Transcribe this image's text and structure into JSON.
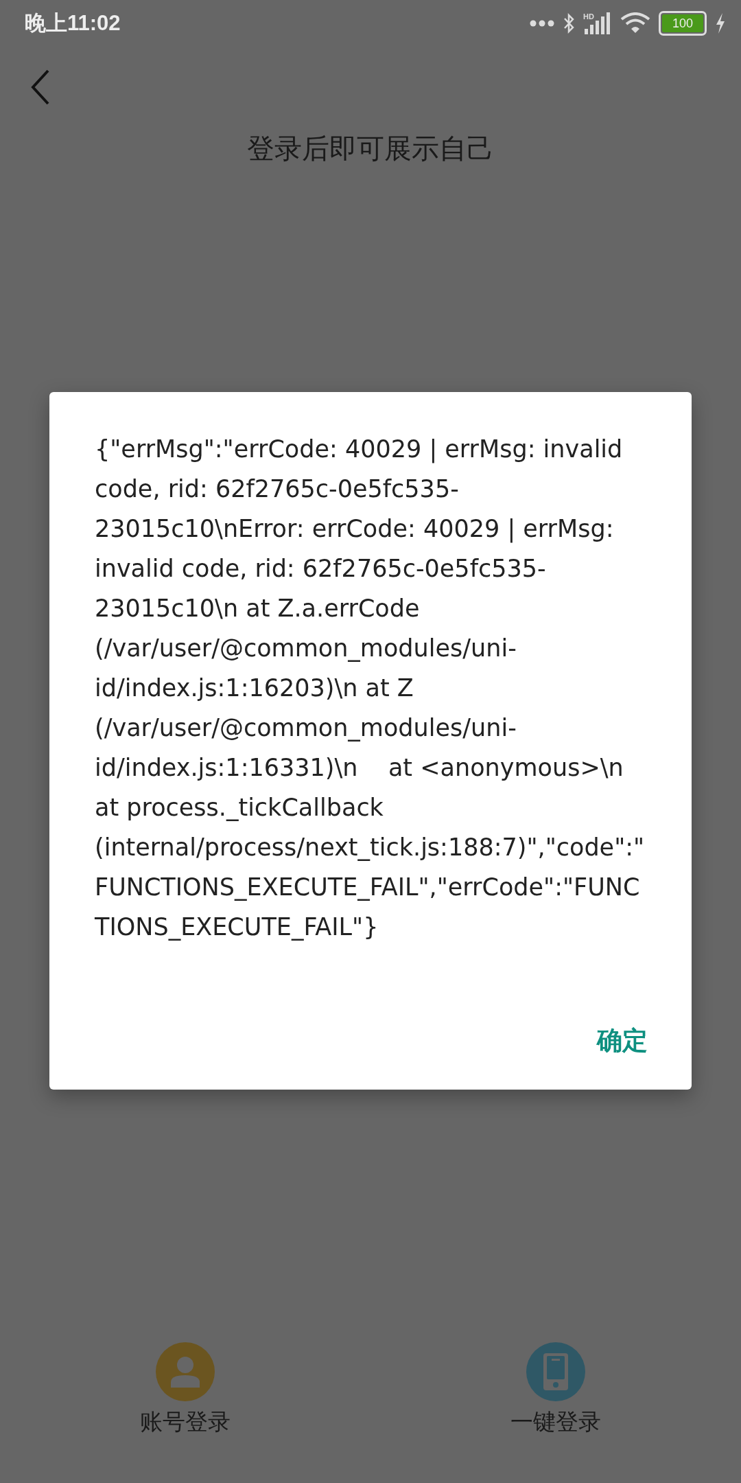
{
  "status_bar": {
    "time": "晚上11:02",
    "battery": "100",
    "network_type": "HD"
  },
  "header": {
    "title": "登录后即可展示自己"
  },
  "dialog": {
    "message": "{\"errMsg\":\"errCode: 40029 | errMsg: invalid code, rid: 62f2765c-0e5fc535-23015c10\\nError: errCode: 40029 | errMsg: invalid code, rid: 62f2765c-0e5fc535-23015c10\\n at Z.a.errCode (/var/user/@common_modules/uni-id/index.js:1:16203)\\n at Z (/var/user/@common_modules/uni-id/index.js:1:16331)\\n    at <anonymous>\\n    at process._tickCallback (internal/process/next_tick.js:188:7)\",\"code\":\"FUNCTIONS_EXECUTE_FAIL\",\"errCode\":\"FUNCTIONS_EXECUTE_FAIL\"}",
    "confirm": "确定"
  },
  "login_options": [
    {
      "kind": "account",
      "label": "账号登录",
      "color": "#6b5520"
    },
    {
      "kind": "phone",
      "label": "一键登录",
      "color": "#2f5866"
    }
  ]
}
